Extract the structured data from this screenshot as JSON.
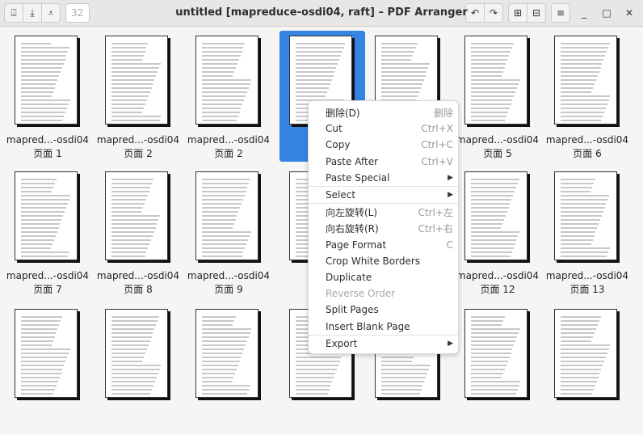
{
  "window": {
    "title": "untitled [mapreduce-osdi04, raft] – PDF Arranger",
    "zoom_value": "32"
  },
  "toolbar": {
    "icons": [
      "import-icon",
      "save-icon",
      "save-as-icon",
      "rotate-left-icon",
      "rotate-right-icon",
      "zoom-in-icon",
      "zoom-out-icon",
      "menu-icon"
    ]
  },
  "pages": [
    {
      "name": "mapred...-osdi04",
      "label": "页面 1"
    },
    {
      "name": "mapred...-osdi04",
      "label": "页面 2"
    },
    {
      "name": "mapred...-osdi04",
      "label": "页面 2"
    },
    {
      "name": "mapr",
      "label": ""
    },
    {
      "name": "",
      "label": ""
    },
    {
      "name": "mapred...-osdi04",
      "label": "页面 5"
    },
    {
      "name": "mapred...-osdi04",
      "label": "页面 6"
    },
    {
      "name": "mapred...-osdi04",
      "label": "页面 7"
    },
    {
      "name": "mapred...-osdi04",
      "label": "页面 8"
    },
    {
      "name": "mapred...-osdi04",
      "label": "页面 9"
    },
    {
      "name": "",
      "label": ""
    },
    {
      "name": "",
      "label": ""
    },
    {
      "name": "mapred...-osdi04",
      "label": "页面 12"
    },
    {
      "name": "mapred...-osdi04",
      "label": "页面 13"
    }
  ],
  "menu": {
    "items": [
      {
        "label": "删除(D)",
        "accel": "删除"
      },
      {
        "label": "Cut",
        "accel": "Ctrl+X"
      },
      {
        "label": "Copy",
        "accel": "Ctrl+C"
      },
      {
        "label": "Paste After",
        "accel": "Ctrl+V"
      },
      {
        "label": "Paste Special",
        "accel": ""
      },
      {
        "label": "Select",
        "accel": ""
      },
      {
        "label": "向左旋转(L)",
        "accel": "Ctrl+左"
      },
      {
        "label": "向右旋转(R)",
        "accel": "Ctrl+右"
      },
      {
        "label": "Page Format",
        "accel": "C"
      },
      {
        "label": "Crop White Borders",
        "accel": ""
      },
      {
        "label": "Duplicate",
        "accel": ""
      },
      {
        "label": "Reverse Order",
        "accel": ""
      },
      {
        "label": "Split Pages",
        "accel": ""
      },
      {
        "label": "Insert Blank Page",
        "accel": ""
      },
      {
        "label": "Export",
        "accel": ""
      }
    ]
  },
  "colors": {
    "selection": "#3584e4"
  }
}
